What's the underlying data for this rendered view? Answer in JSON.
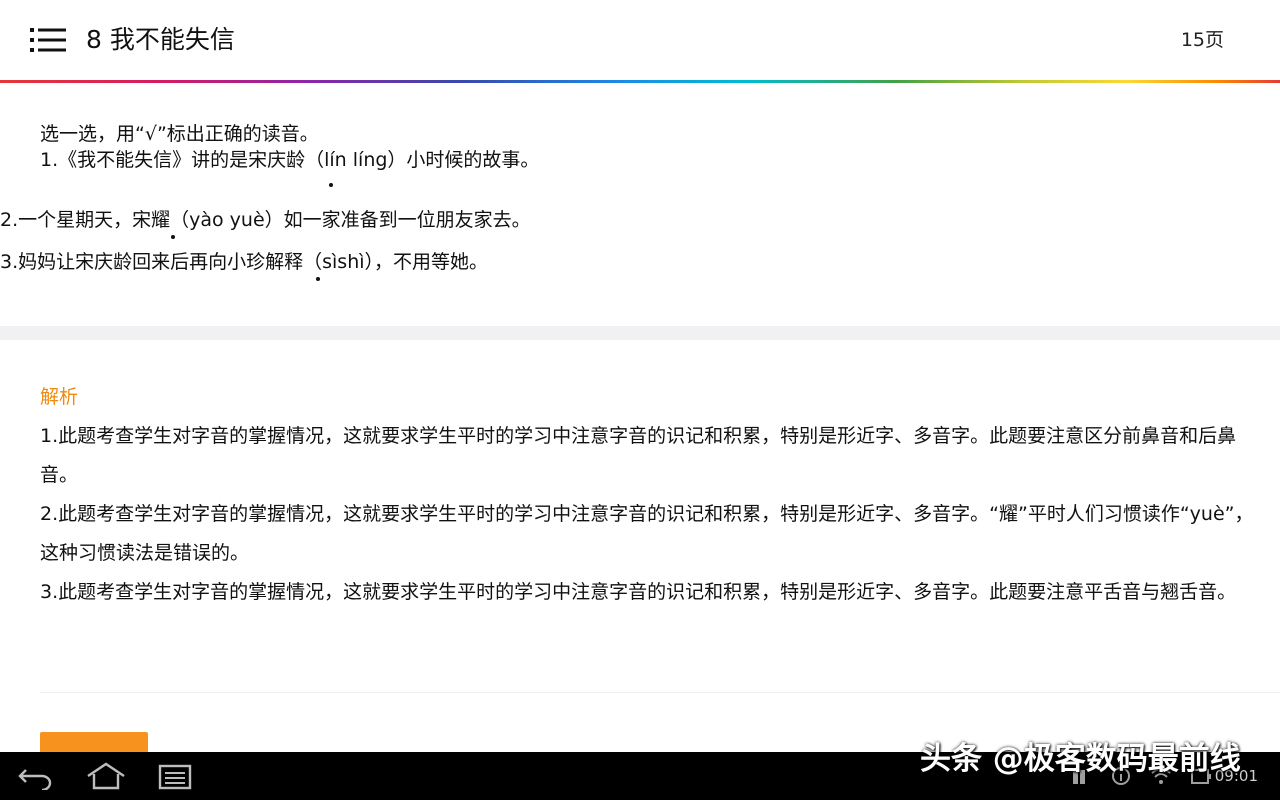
{
  "header": {
    "title": "8 我不能失信",
    "page_count": "15页"
  },
  "question": {
    "intro": "选一选，用“√”标出正确的读音。",
    "q1": "1.《我不能失信》讲的是宋庆龄（lín líng）小时候的故事。",
    "q2": "2.一个星期天，宋耀（yào yuè）如一家准备到一位朋友家去。",
    "q3": "3.妈妈让宋庆龄回来后再向小珍解释（sìshì），不用等她。"
  },
  "analysis": {
    "title": "解析",
    "p1": "1.此题考查学生对字音的掌握情况，这就要求学生平时的学习中注意字音的识记和积累，特别是形近字、多音字。此题要注意区分前鼻音和后鼻音。",
    "p2": "2.此题考查学生对字音的掌握情况，这就要求学生平时的学习中注意字音的识记和积累，特别是形近字、多音字。“耀”平时人们习惯读作“yuè”，这种习惯读法是错误的。",
    "p3": "3.此题考查学生对字音的掌握情况，这就要求学生平时的学习中注意字音的识记和积累，特别是形近字、多音字。此题要注意平舌音与翘舌音。"
  },
  "system_bar": {
    "clock": "09:01",
    "icons": [
      "back-icon",
      "home-icon",
      "recent-apps-icon",
      "notification-icon",
      "info-icon",
      "wifi-icon",
      "battery-icon"
    ]
  },
  "watermark": "头条 @极客数码最前线",
  "colors": {
    "accent": "#f7921e",
    "analysis_title": "#f08a12",
    "separator": "#f1f1f4"
  }
}
